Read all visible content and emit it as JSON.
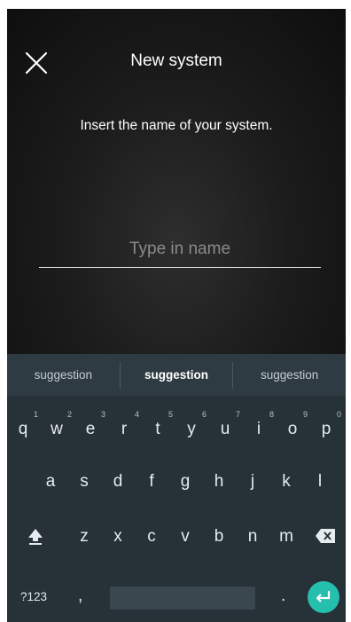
{
  "header": {
    "title": "New system"
  },
  "body": {
    "instruction": "Insert the name of your system.",
    "name_input": {
      "placeholder": "Type in name",
      "value": ""
    }
  },
  "keyboard": {
    "suggestions": [
      "suggestion",
      "suggestion",
      "suggestion"
    ],
    "row1": [
      {
        "key": "q",
        "hint": "1"
      },
      {
        "key": "w",
        "hint": "2"
      },
      {
        "key": "e",
        "hint": "3"
      },
      {
        "key": "r",
        "hint": "4"
      },
      {
        "key": "t",
        "hint": "5"
      },
      {
        "key": "y",
        "hint": "6"
      },
      {
        "key": "u",
        "hint": "7"
      },
      {
        "key": "i",
        "hint": "8"
      },
      {
        "key": "o",
        "hint": "9"
      },
      {
        "key": "p",
        "hint": "0"
      }
    ],
    "row2": [
      "a",
      "s",
      "d",
      "f",
      "g",
      "h",
      "j",
      "k",
      "l"
    ],
    "row3": [
      "z",
      "x",
      "c",
      "v",
      "b",
      "n",
      "m"
    ],
    "symbols_label": "?123",
    "comma": ",",
    "period": ".",
    "accent_color": "#26bfae"
  }
}
